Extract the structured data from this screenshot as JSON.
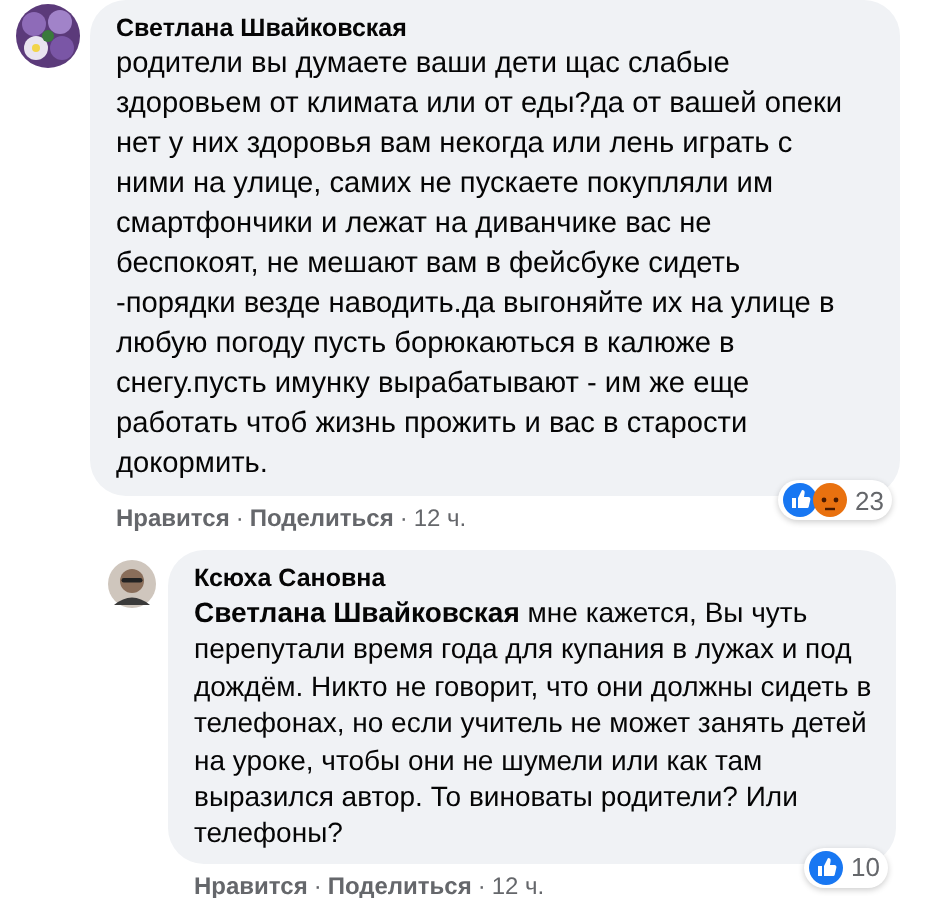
{
  "comments": [
    {
      "author": "Светлана Швайковская",
      "text": "родители вы думаете ваши дети щас слабые здоровьем от климата или от еды?да от вашей опеки нет у них здоровья вам некогда или лень играть с ними на улице, самих не пускаете покупляли им смартфончики и лежат на диванчике вас не беспокоят, не мешают вам в фейсбуке сидеть -порядки везде наводить.да выгоняйте их на улице в любую погоду пусть борюкаються в калюже в снегу.пусть имунку вырабатывают - им же еще работать чтоб жизнь прожить и вас в старости докормить.",
      "reply": false,
      "reactions": [
        {
          "kind": "like"
        },
        {
          "kind": "angry"
        }
      ],
      "reaction_count": "23",
      "actions": [
        "Нравится",
        "Поделиться"
      ],
      "separator": "·",
      "time": "12 ч."
    },
    {
      "author": "Ксюха Сановна",
      "text": "**Светлана Швайковская** мне кажется, Вы чуть перепутали время года для купания в лужах и под дождём. Никто не говорит, что они должны сидеть в телефонах, но если учитель не может занять детей на уроке, чтобы они не шумели или как там выразился автор. То виноваты родители? Или телефоны?",
      "reply": true,
      "reactions": [
        {
          "kind": "like"
        }
      ],
      "reaction_count": "10",
      "actions": [
        "Нравится",
        "Поделиться"
      ],
      "separator": "·",
      "time": "12 ч."
    }
  ]
}
